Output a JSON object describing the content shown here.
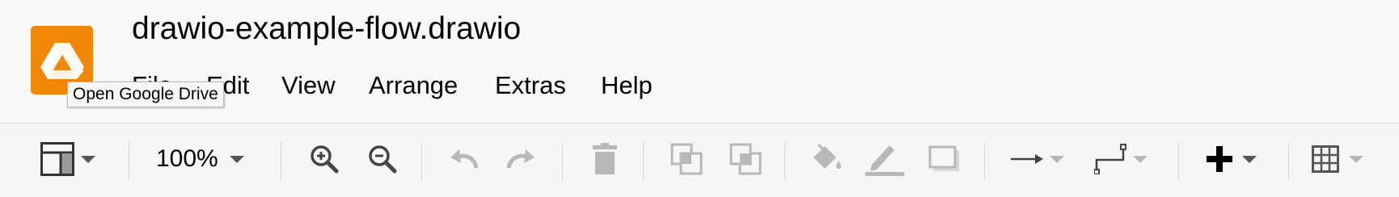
{
  "app": {
    "title": "drawio-example-flow.drawio",
    "brand_color": "#f08705"
  },
  "menu": {
    "items": [
      {
        "label": "File"
      },
      {
        "label": "Edit"
      },
      {
        "label": "View"
      },
      {
        "label": "Arrange"
      },
      {
        "label": "Extras"
      },
      {
        "label": "Help"
      }
    ]
  },
  "tooltip": {
    "text": "Open Google Drive"
  },
  "toolbar": {
    "zoom_label": "100%",
    "icons": [
      "format-panel-icon",
      "zoom-in-icon",
      "zoom-out-icon",
      "undo-icon",
      "redo-icon",
      "delete-icon",
      "to-front-icon",
      "to-back-icon",
      "fill-color-icon",
      "line-color-icon",
      "shadow-icon",
      "connection-arrow-icon",
      "waypoints-icon",
      "insert-plus-icon",
      "table-icon"
    ],
    "colors": {
      "enabled": "#444444",
      "disabled": "#b8b8b8"
    }
  }
}
